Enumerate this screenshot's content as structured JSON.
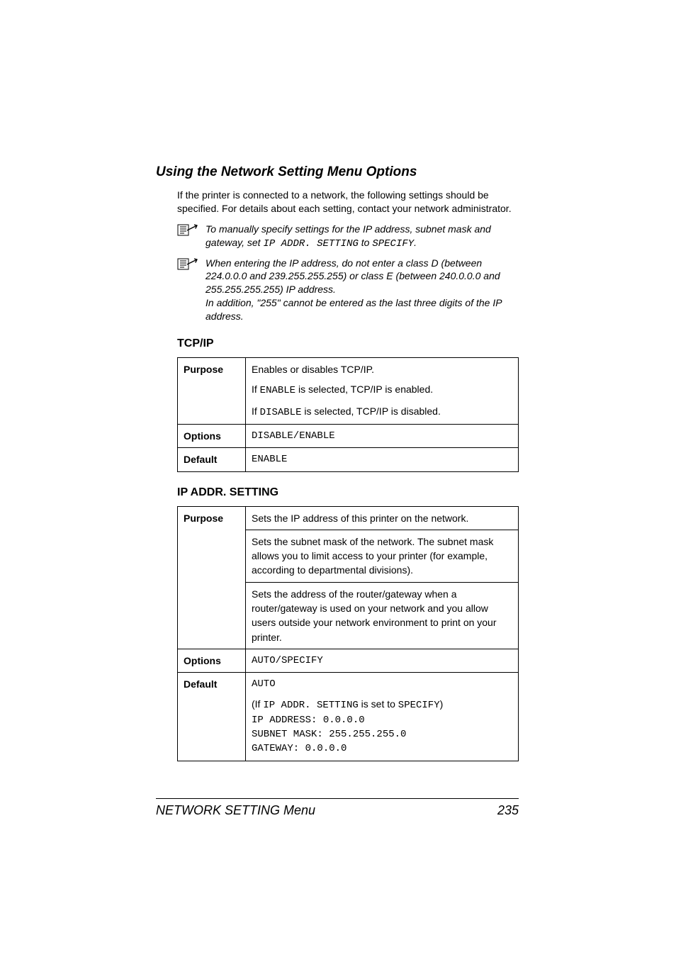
{
  "section": {
    "title": "Using the Network Setting Menu Options",
    "intro": "If the printer is connected to a network, the following settings should be specified. For details about each setting, contact your network administrator.",
    "note1_pre": "To manually specify settings for the IP address, subnet mask and gateway, set ",
    "note1_code1": "IP ADDR. SETTING",
    "note1_mid": " to ",
    "note1_code2": "SPECIFY",
    "note1_suffix": ".",
    "note2_p1": "When entering the IP address, do not enter a class D (between 224.0.0.0 and 239.255.255.255) or class E (between 240.0.0.0 and 255.255.255.255) IP address.",
    "note2_p2": "In addition, \"255\" cannot be entered as the last three digits of the IP address."
  },
  "tcpip": {
    "heading": "TCP/IP",
    "labels": {
      "purpose": "Purpose",
      "options": "Options",
      "default": "Default"
    },
    "purpose_p1": "Enables or disables TCP/IP.",
    "purpose_p2a": "If ",
    "purpose_p2b": "ENABLE",
    "purpose_p2c": " is selected, TCP/IP is enabled.",
    "purpose_p3a": "If ",
    "purpose_p3b": "DISABLE",
    "purpose_p3c": " is selected, TCP/IP is disabled.",
    "options": "DISABLE/ENABLE",
    "default": "ENABLE"
  },
  "ipaddr": {
    "heading": "IP ADDR. SETTING",
    "labels": {
      "purpose": "Purpose",
      "options": "Options",
      "default": "Default"
    },
    "purpose_p1": "Sets the IP address of this printer on the network.",
    "purpose_p2": "Sets the subnet mask of the network. The subnet mask allows you to limit access to your printer (for example, according to departmental divisions).",
    "purpose_p3": "Sets the address of the router/gateway when a router/gateway is used on your network and you allow users outside your network environment to print on your printer.",
    "options": "AUTO/SPECIFY",
    "default_l1": "AUTO",
    "default_if_pre": "(If ",
    "default_if_code": "IP ADDR. SETTING",
    "default_if_mid": " is set to ",
    "default_if_code2": "SPECIFY",
    "default_if_suffix": ")",
    "default_l3": "IP ADDRESS: 0.0.0.0",
    "default_l4": "SUBNET MASK: 255.255.255.0",
    "default_l5": "GATEWAY: 0.0.0.0"
  },
  "footer": {
    "left": "NETWORK SETTING Menu",
    "right": "235"
  }
}
